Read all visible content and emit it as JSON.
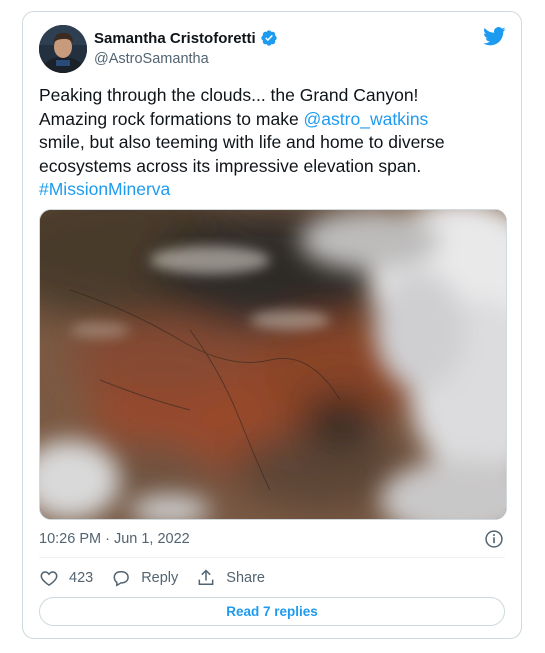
{
  "tweet": {
    "author": {
      "display_name": "Samantha Cristoforetti",
      "handle": "@AstroSamantha",
      "verified": true,
      "avatar_icon": "astronaut-avatar"
    },
    "brand_icon": "twitter-bird-icon",
    "text_parts": {
      "line_1": "Peaking through the clouds... the Grand Canyon!",
      "line_2_prefix": "Amazing rock formations to make ",
      "mention": "@astro_watkins",
      "line_3": "smile, but also teeming with life and home to diverse",
      "line_4": "ecosystems across its impressive elevation span.",
      "hashtag": "#MissionMinerva"
    },
    "media": {
      "type": "image"
    },
    "timestamp": "10:26 PM · Jun 1, 2022",
    "actions": {
      "like_count": "423",
      "reply_label": "Reply",
      "share_label": "Share"
    },
    "read_replies_label": "Read 7 replies"
  },
  "colors": {
    "link": "#1d9bf0",
    "secondary_text": "#536471",
    "border": "#cfd9de"
  }
}
